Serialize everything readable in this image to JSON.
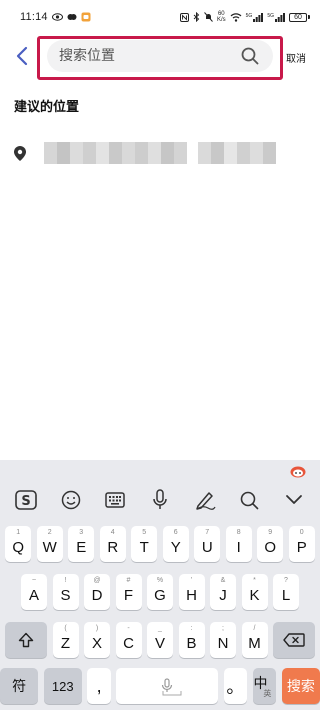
{
  "status_bar": {
    "time": "11:14",
    "net_speed_value": "60",
    "net_speed_unit": "K/s",
    "signal_tag_1": "5G",
    "signal_tag_2": "5G",
    "battery": "60"
  },
  "search": {
    "placeholder": "搜索位置",
    "value": "",
    "cancel_label": "取消",
    "highlight_color": "#c8194a"
  },
  "suggestions": {
    "title": "建议的位置",
    "items": [
      {
        "text": ""
      }
    ]
  },
  "keyboard": {
    "row1": [
      {
        "label": "Q",
        "sub": "1"
      },
      {
        "label": "W",
        "sub": "2"
      },
      {
        "label": "E",
        "sub": "3"
      },
      {
        "label": "R",
        "sub": "4"
      },
      {
        "label": "T",
        "sub": "5"
      },
      {
        "label": "Y",
        "sub": "6"
      },
      {
        "label": "U",
        "sub": "7"
      },
      {
        "label": "I",
        "sub": "8"
      },
      {
        "label": "O",
        "sub": "9"
      },
      {
        "label": "P",
        "sub": "0"
      }
    ],
    "row2": [
      {
        "label": "A",
        "sub": "~"
      },
      {
        "label": "S",
        "sub": "!"
      },
      {
        "label": "D",
        "sub": "@"
      },
      {
        "label": "F",
        "sub": "#"
      },
      {
        "label": "G",
        "sub": "%"
      },
      {
        "label": "H",
        "sub": "'"
      },
      {
        "label": "J",
        "sub": "&"
      },
      {
        "label": "K",
        "sub": "*"
      },
      {
        "label": "L",
        "sub": "?"
      }
    ],
    "row3": [
      {
        "label": "Z",
        "sub": "("
      },
      {
        "label": "X",
        "sub": ")"
      },
      {
        "label": "C",
        "sub": "-"
      },
      {
        "label": "V",
        "sub": "_"
      },
      {
        "label": "B",
        "sub": ":"
      },
      {
        "label": "N",
        "sub": ";"
      },
      {
        "label": "M",
        "sub": "/"
      }
    ],
    "symbol_key": "符",
    "number_key": "123",
    "comma_key": ",",
    "period_key": "。",
    "lang_key_main": "中",
    "lang_key_sub": "英",
    "search_key": "搜索",
    "accent_color": "#f07a4d",
    "icons": [
      "sogou-logo-icon",
      "emoji-icon",
      "keyboard-icon",
      "microphone-icon",
      "handwriting-icon",
      "search-icon",
      "collapse-icon"
    ]
  }
}
